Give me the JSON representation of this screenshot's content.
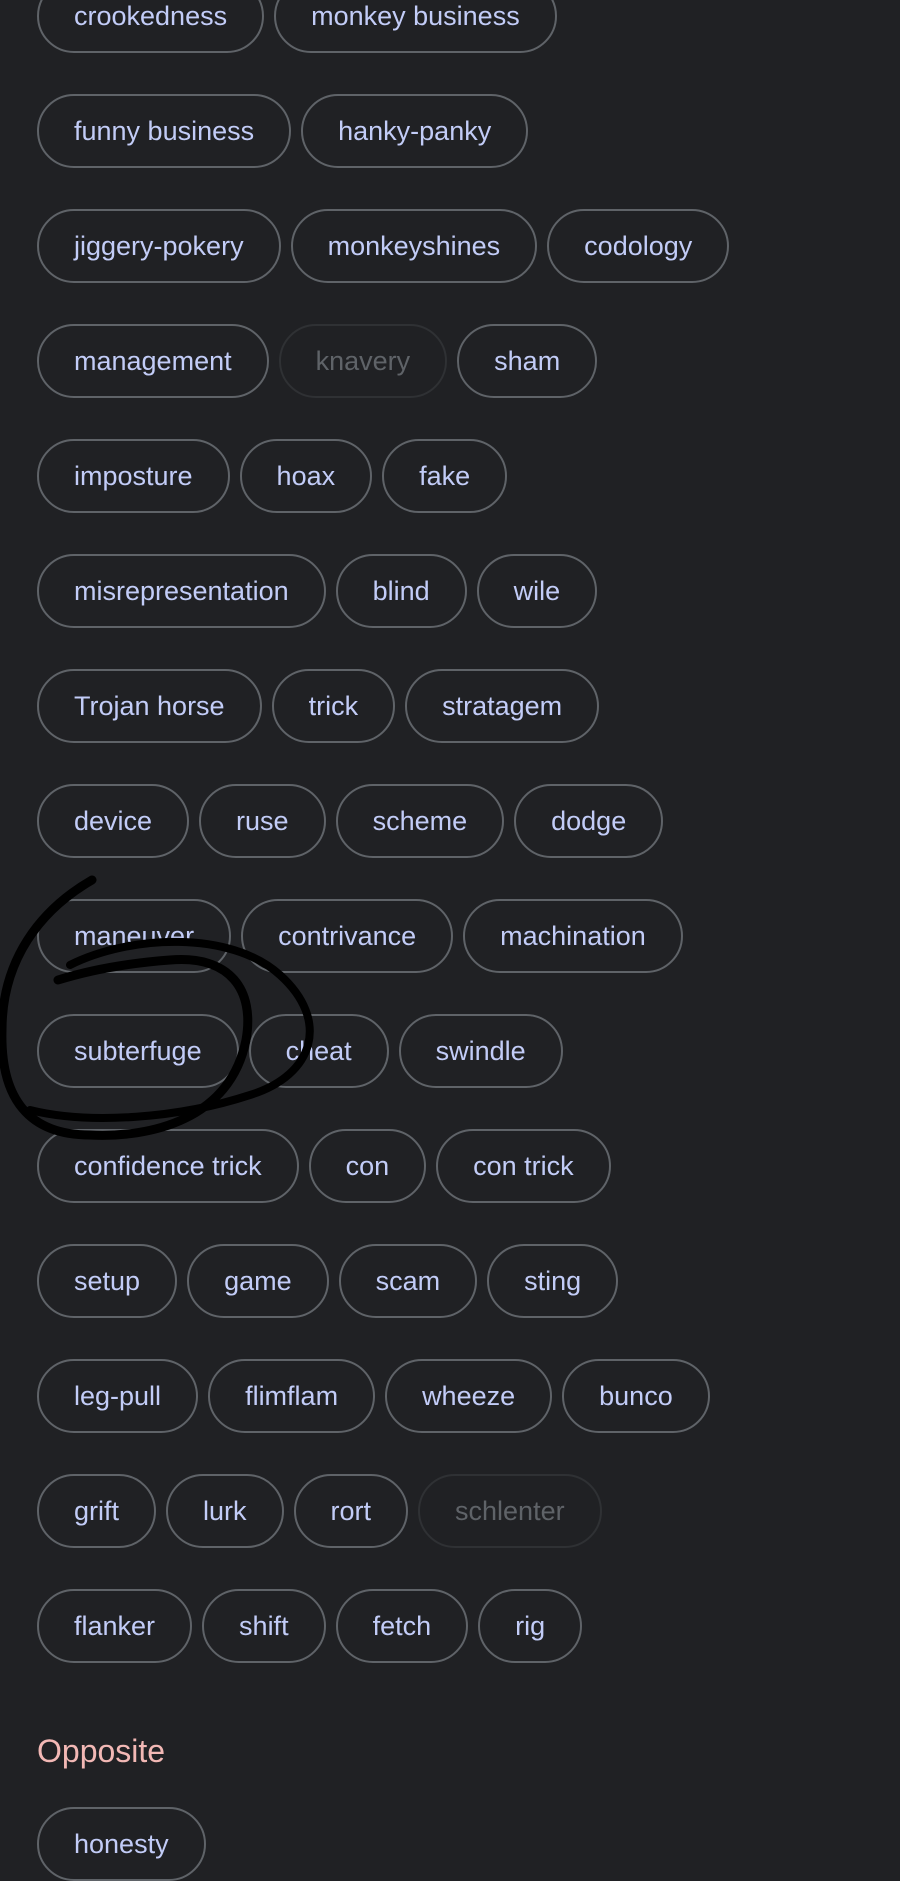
{
  "synonym_rows": [
    [
      "crookedness",
      "monkey business"
    ],
    [
      "funny business",
      "hanky-panky"
    ],
    [
      "jiggery-pokery",
      "monkeyshines",
      "codology"
    ],
    [
      "management",
      "knavery",
      "sham"
    ],
    [
      "imposture",
      "hoax",
      "fake"
    ],
    [
      "misrepresentation",
      "blind",
      "wile"
    ],
    [
      "Trojan horse",
      "trick",
      "stratagem"
    ],
    [
      "device",
      "ruse",
      "scheme",
      "dodge"
    ],
    [
      "maneuver",
      "contrivance",
      "machination"
    ],
    [
      "subterfuge",
      "cheat",
      "swindle"
    ],
    [
      "confidence trick",
      "con",
      "con trick"
    ],
    [
      "setup",
      "game",
      "scam",
      "sting"
    ],
    [
      "leg-pull",
      "flimflam",
      "wheeze",
      "bunco"
    ],
    [
      "grift",
      "lurk",
      "rort",
      "schlenter"
    ],
    [
      "flanker",
      "shift",
      "fetch",
      "rig"
    ]
  ],
  "disabled_chips": [
    "knavery",
    "schlenter"
  ],
  "opposite": {
    "title": "Opposite",
    "items": [
      "honesty"
    ]
  },
  "colors": {
    "background": "#202124",
    "chip_text": "#c2ccf7",
    "chip_border": "#5f6368",
    "disabled_text": "#5f6368",
    "section_title": "#f2b8b5",
    "annotation_ink": "#000000"
  }
}
